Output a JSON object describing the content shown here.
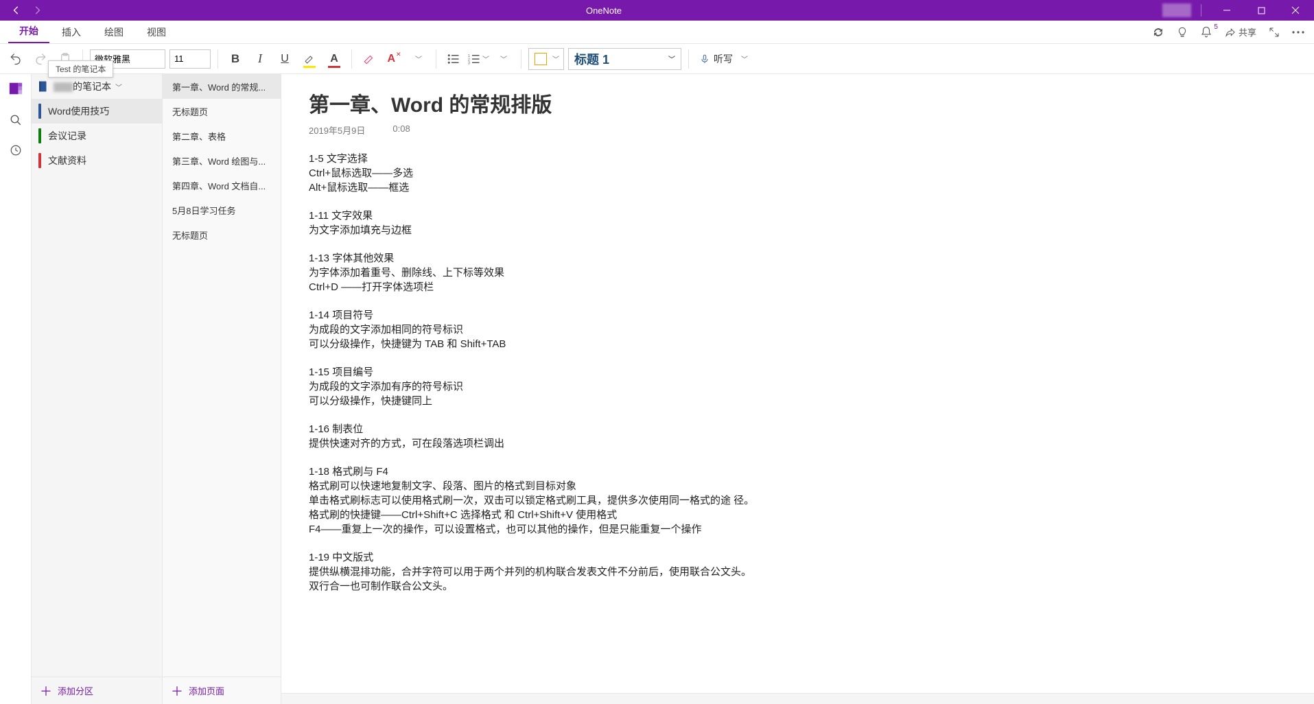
{
  "app": {
    "title": "OneNote"
  },
  "tabs": {
    "items": [
      "开始",
      "插入",
      "绘图",
      "视图"
    ],
    "active": 0,
    "share_label": "共享"
  },
  "ribbon": {
    "font_name": "微软雅黑",
    "font_size": "11",
    "style_label": "标题 1",
    "dictate_label": "听写"
  },
  "notebook": {
    "header_suffix": "的笔记本",
    "tooltip": "Test 的笔记本"
  },
  "sections": [
    {
      "label": "Word使用技巧",
      "color": "#2b579a",
      "active": true
    },
    {
      "label": "会议记录",
      "color": "#107c10",
      "active": false
    },
    {
      "label": "文献资料",
      "color": "#d13438",
      "active": false
    }
  ],
  "pages": [
    {
      "label": "第一章、Word 的常规...",
      "active": true
    },
    {
      "label": "无标题页",
      "active": false
    },
    {
      "label": "第二章、表格",
      "active": false
    },
    {
      "label": "第三章、Word 绘图与...",
      "active": false
    },
    {
      "label": "第四章、Word 文档自...",
      "active": false
    },
    {
      "label": "5月8日学习任务",
      "active": false
    },
    {
      "label": "无标题页",
      "active": false
    }
  ],
  "add": {
    "section": "添加分区",
    "page": "添加页面"
  },
  "note": {
    "title": "第一章、Word 的常规排版",
    "date": "2019年5月9日",
    "time": "0:08",
    "blocks": [
      [
        "1-5 文字选择",
        "Ctrl+鼠标选取——多选",
        "Alt+鼠标选取——框选"
      ],
      [
        "1-11 文字效果",
        "为文字添加填充与边框"
      ],
      [
        "1-13 字体其他效果",
        "为字体添加着重号、删除线、上下标等效果",
        "Ctrl+D ——打开字体选项栏"
      ],
      [
        "1-14 项目符号",
        "为成段的文字添加相同的符号标识",
        "可以分级操作，快捷键为 TAB 和 Shift+TAB"
      ],
      [
        "1-15 项目编号",
        "为成段的文字添加有序的符号标识",
        "可以分级操作，快捷键同上"
      ],
      [
        "1-16 制表位",
        "提供快速对齐的方式，可在段落选项栏调出"
      ],
      [
        "1-18 格式刷与 F4",
        "格式刷可以快速地复制文字、段落、图片的格式到目标对象",
        "单击格式刷标志可以使用格式刷一次，双击可以锁定格式刷工具，提供多次使用同一格式的途 径。",
        "格式刷的快捷键——Ctrl+Shift+C 选择格式 和 Ctrl+Shift+V 使用格式",
        "F4——重复上一次的操作，可以设置格式，也可以其他的操作，但是只能重复一个操作"
      ],
      [
        "1-19 中文版式",
        "提供纵横混排功能，合并字符可以用于两个并列的机构联合发表文件不分前后，使用联合公文头。",
        "双行合一也可制作联合公文头。"
      ]
    ]
  },
  "notif_count": "5"
}
